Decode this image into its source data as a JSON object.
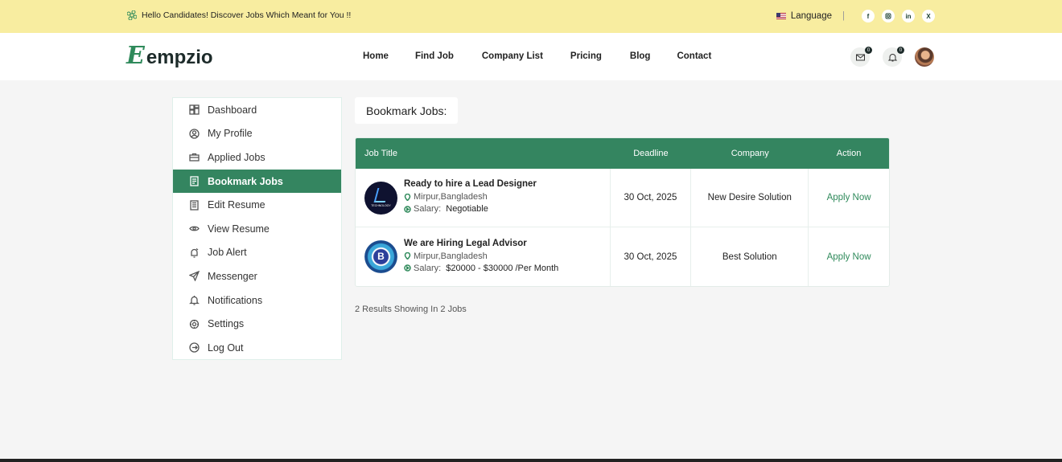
{
  "topbar": {
    "greeting": "Hello Candidates! Discover Jobs Which Meant for You !!",
    "language": "Language",
    "social": [
      "f",
      "ig",
      "in",
      "X"
    ]
  },
  "nav": {
    "logo_mark": "E",
    "logo_text": "empzio",
    "menu": [
      "Home",
      "Find Job",
      "Company List",
      "Pricing",
      "Blog",
      "Contact"
    ],
    "mail_count": "0",
    "notif_count": "0"
  },
  "sidebar": {
    "items": [
      {
        "label": "Dashboard",
        "icon": "dashboard-icon"
      },
      {
        "label": "My Profile",
        "icon": "profile-icon"
      },
      {
        "label": "Applied Jobs",
        "icon": "briefcase-icon"
      },
      {
        "label": "Bookmark Jobs",
        "icon": "bookmark-icon",
        "active": true
      },
      {
        "label": "Edit Resume",
        "icon": "edit-resume-icon"
      },
      {
        "label": "View Resume",
        "icon": "eye-icon"
      },
      {
        "label": "Job Alert",
        "icon": "alert-icon"
      },
      {
        "label": "Messenger",
        "icon": "send-icon"
      },
      {
        "label": "Notifications",
        "icon": "bell-icon"
      },
      {
        "label": "Settings",
        "icon": "settings-icon"
      },
      {
        "label": "Log Out",
        "icon": "logout-icon"
      }
    ]
  },
  "main": {
    "title": "Bookmark Jobs:",
    "table": {
      "headers": [
        "Job Title",
        "Deadline",
        "Company",
        "Action"
      ],
      "rows": [
        {
          "title": "Ready to hire a Lead Designer",
          "location": "Mirpur,Bangladesh",
          "salary_label": "Salary:",
          "salary": "Negotiable",
          "deadline": "30 Oct, 2025",
          "company": "New Desire Solution",
          "action": "Apply Now",
          "logo_text": "TECHNOLOGY"
        },
        {
          "title": "We are Hiring Legal Advisor",
          "location": "Mirpur,Bangladesh",
          "salary_label": "Salary:",
          "salary": "$20000 - $30000 /Per Month",
          "deadline": "30 Oct, 2025",
          "company": "Best Solution",
          "action": "Apply Now",
          "logo_text": "B"
        }
      ]
    },
    "results": "2 Results Showing In 2 Jobs"
  },
  "colors": {
    "topbar": "#f8eda0",
    "accent": "#348560",
    "link": "#2f8a5b"
  }
}
